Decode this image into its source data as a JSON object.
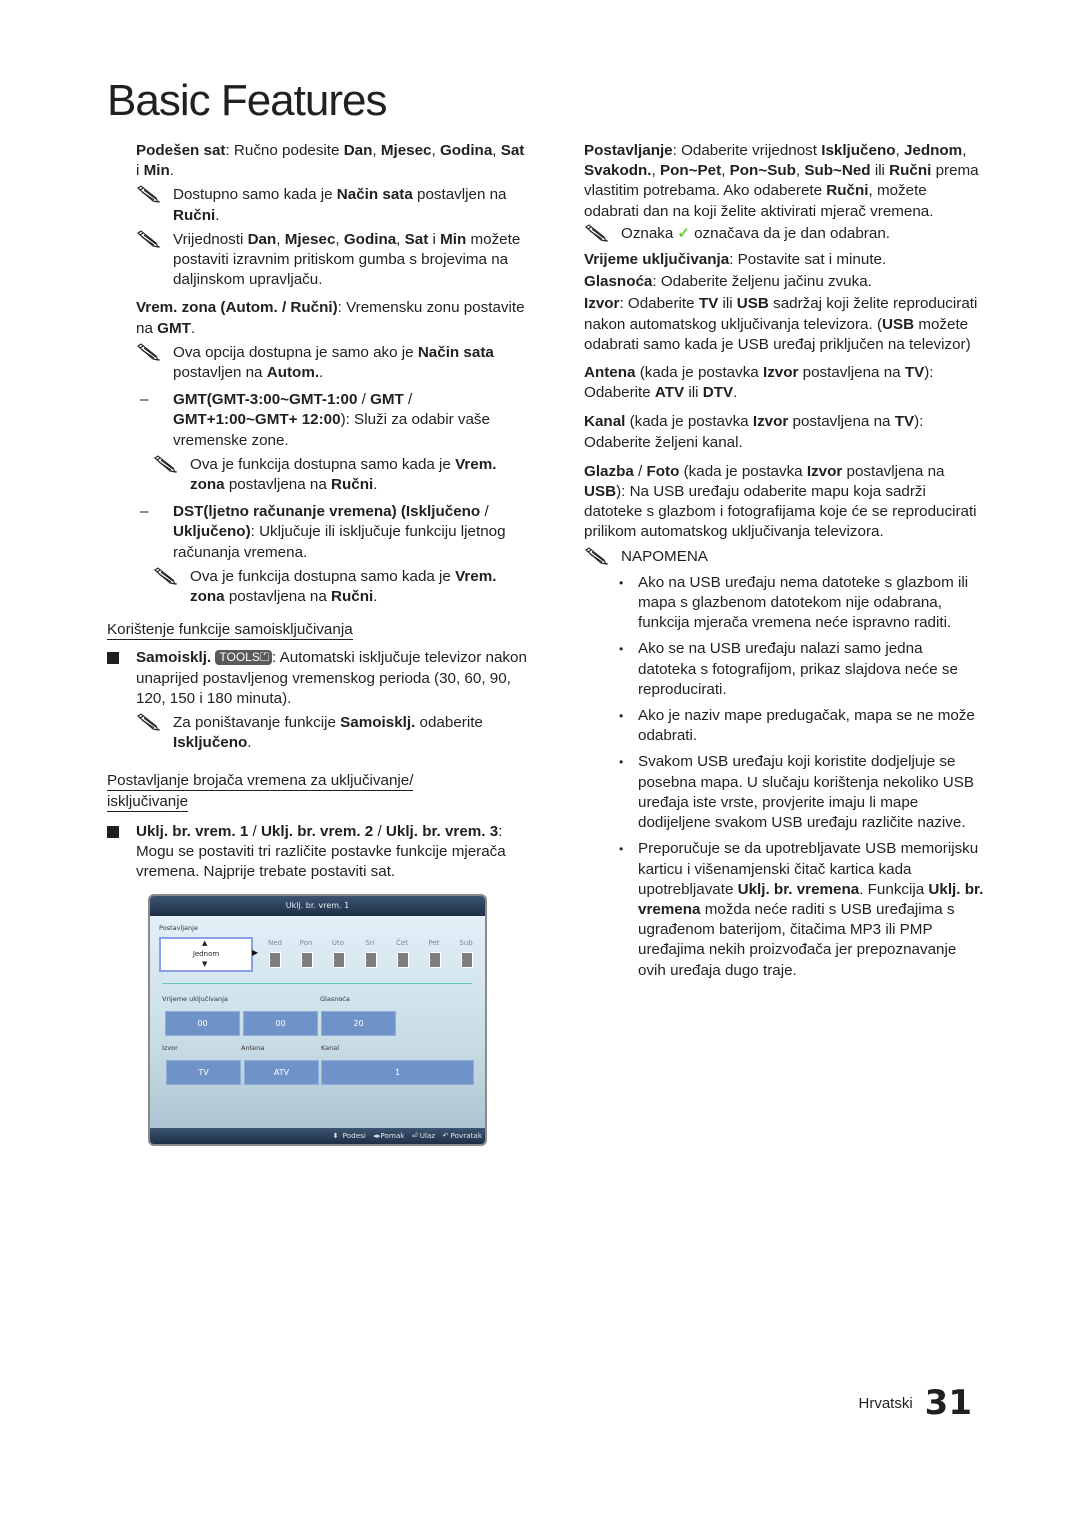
{
  "page": {
    "title": "Basic Features",
    "language": "Hrvatski",
    "page_number": "31"
  },
  "icons": {
    "note": "pencil-note-icon",
    "check": "checkmark-icon",
    "bullet_square": "square-bullet-icon",
    "tools_button": "tools-button-icon"
  },
  "left": {
    "p1": {
      "b1": "Podešen sat",
      "t1": ": Ručno podesite ",
      "b2": "Dan",
      "t2": ", ",
      "b3": "Mjesec",
      "t3": ", ",
      "b4": "Godina",
      "t4": ", ",
      "b5": "Sat",
      "t5": " i ",
      "b6": "Min",
      "t6": "."
    },
    "n1": {
      "t1": "Dostupno samo kada je ",
      "b1": "Način sata",
      "t2": " postavljen na ",
      "b2": "Ručni",
      "t3": "."
    },
    "n2": {
      "t1": "Vrijednosti ",
      "b1": "Dan",
      "t2": ", ",
      "b2": "Mjesec",
      "t3": ", ",
      "b3": "Godina",
      "t4": ", ",
      "b4": "Sat",
      "t5": " i ",
      "b5": "Min",
      "t6": " možete postaviti izravnim pritiskom gumba s brojevima na daljinskom upravljaču."
    },
    "p2": {
      "b1": "Vrem. zona (Autom. / Ručni)",
      "t1": ": Vremensku zonu postavite na ",
      "b2": "GMT",
      "t2": "."
    },
    "n3": {
      "t1": "Ova opcija dostupna je samo ako je ",
      "b1": "Način sata",
      "t2": " postavljen na ",
      "b2": "Autom.",
      "t3": "."
    },
    "d1": {
      "dash": "–",
      "b1": "GMT(GMT-3:00~GMT-1:00",
      "t1": " / ",
      "b2": "GMT",
      "t2": " / ",
      "b3": "GMT+1:00~GMT+ 12:00",
      "t3": "): Služi za odabir vaše vremenske zone."
    },
    "n4": {
      "t1": "Ova je funkcija dostupna samo kada je ",
      "b1": "Vrem. zona",
      "t2": " postavljena na ",
      "b2": "Ručni",
      "t3": "."
    },
    "d2": {
      "dash": "–",
      "b1": "DST(ljetno računanje vremena) (Isključeno",
      "t1": " / ",
      "b2": "Uključeno)",
      "t2": ": Uključuje ili isključuje funkciju ljetnog računanja vremena."
    },
    "n5": {
      "t1": "Ova je funkcija dostupna samo kada je ",
      "b1": "Vrem. zona",
      "t2": " postavljena na ",
      "b2": "Ručni",
      "t3": "."
    },
    "h1": "Korištenje funkcije samoisključivanja",
    "s1": {
      "b1": "Samoisklj.",
      "tools": "TOOLS",
      "t1": ": Automatski isključuje televizor nakon unaprijed postavljenog vremenskog perioda (30, 60, 90, 120, 150 i 180 minuta)."
    },
    "n6": {
      "t1": "Za poništavanje funkcije ",
      "b1": "Samoisklj.",
      "t2": " odaberite ",
      "b2": "Isključeno",
      "t3": "."
    },
    "h2": "Postavljanje brojača vremena za uključivanje/ isključivanje",
    "s2": {
      "b1": "Uklj. br. vrem. 1",
      "t1": " / ",
      "b2": "Uklj. br. vrem. 2",
      "t2": " / ",
      "b3": "Uklj. br. vrem. 3",
      "t3": ": Mogu se postaviti tri različite postavke funkcije mjerača vremena. Najprije trebate postaviti sat."
    }
  },
  "tv_ui": {
    "header": "Uklj. br. vrem. 1",
    "setup_label": "Postavljanje",
    "setup_value": "Jednom",
    "days": [
      "Ned",
      "Pon",
      "Uto",
      "Sri",
      "Čet",
      "Pet",
      "Sub"
    ],
    "on_time_label": "Vrijeme uključivanja",
    "hour": "00",
    "minute": "00",
    "volume_label": "Glasnoća",
    "volume": "20",
    "source_label": "Izvor",
    "source": "TV",
    "antenna_label": "Antena",
    "antenna": "ATV",
    "channel_label": "Kanal",
    "channel": "1",
    "footer": {
      "adjust": "Podesi",
      "move": "Pomak",
      "enter": "Ulaz",
      "return": "Povratak"
    }
  },
  "right": {
    "p1": {
      "b1": "Postavljanje",
      "t1": ": Odaberite vrijednost ",
      "b2": "Isključeno",
      "t2": ", ",
      "b3": "Jednom",
      "t3": ", ",
      "b4": "Svakodn.",
      "t4": ", ",
      "b5": "Pon~Pet",
      "t5": ", ",
      "b6": "Pon~Sub",
      "t6": ", ",
      "b7": "Sub~Ned",
      "t7": " ili ",
      "b8": "Ručni",
      "t8": " prema vlastitim potrebama. Ako odaberete ",
      "b9": "Ručni",
      "t9": ", možete odabrati dan na koji želite aktivirati mjerač vremena."
    },
    "n1": {
      "t1": "Oznaka",
      "check": "✓",
      "t2": "označava da je dan odabran."
    },
    "p2": {
      "b1": "Vrijeme uključivanja",
      "t1": ": Postavite sat i minute."
    },
    "p3": {
      "b1": "Glasnoća",
      "t1": ": Odaberite željenu jačinu zvuka."
    },
    "p4": {
      "b1": "Izvor",
      "t1": ": Odaberite ",
      "b2": "TV",
      "t2": " ili ",
      "b3": "USB",
      "t3": " sadržaj koji želite reproducirati nakon automatskog uključivanja televizora. (",
      "b4": "USB",
      "t4": " možete odabrati samo kada je USB uređaj priključen na televizor)"
    },
    "p5": {
      "b1": "Antena",
      "t1": " (kada je postavka ",
      "b2": "Izvor",
      "t2": " postavljena na ",
      "b3": "TV",
      "t3": "): Odaberite ",
      "b4": "ATV",
      "t4": " ili ",
      "b5": "DTV",
      "t5": "."
    },
    "p6": {
      "b1": "Kanal",
      "t1": " (kada je postavka ",
      "b2": "Izvor",
      "t2": " postavljena na ",
      "b3": "TV",
      "t3": "): Odaberite željeni kanal."
    },
    "p7": {
      "b1": "Glazba",
      "t1": " / ",
      "b2": "Foto",
      "t2": " (kada je postavka ",
      "b3": "Izvor",
      "t3": " postavljena na ",
      "b4": "USB",
      "t4": "): Na USB uređaju odaberite mapu koja sadrži datoteke s glazbom i fotografijama koje će se reproducirati prilikom automatskog uključivanja televizora."
    },
    "note_head": "NAPOMENA",
    "bullets": [
      "Ako na USB uređaju nema datoteke s glazbom ili mapa s glazbenom datotekom nije odabrana, funkcija mjerača vremena neće ispravno raditi.",
      "Ako se na USB uređaju nalazi samo jedna datoteka s fotografijom, prikaz slajdova neće se reproducirati.",
      "Ako je naziv mape predugačak, mapa se ne može odabrati.",
      "Svakom USB uređaju koji koristite dodjeljuje se posebna mapa. U slučaju korištenja nekoliko USB uređaja iste vrste, provjerite imaju li mape dodijeljene svakom USB uređaju različite nazive."
    ],
    "b5": {
      "t1": "Preporučuje se da upotrebljavate USB memorijsku karticu i višenamjenski čitač kartica kada upotrebljavate ",
      "b1": "Uklj. br. vremena",
      "t2": ". Funkcija ",
      "b2": "Uklj. br. vremena",
      "t3": " možda neće raditi s USB uređajima s ugrađenom baterijom, čitačima MP3 ili PMP uređajima nekih proizvođača jer prepoznavanje ovih uređaja dugo traje."
    }
  }
}
